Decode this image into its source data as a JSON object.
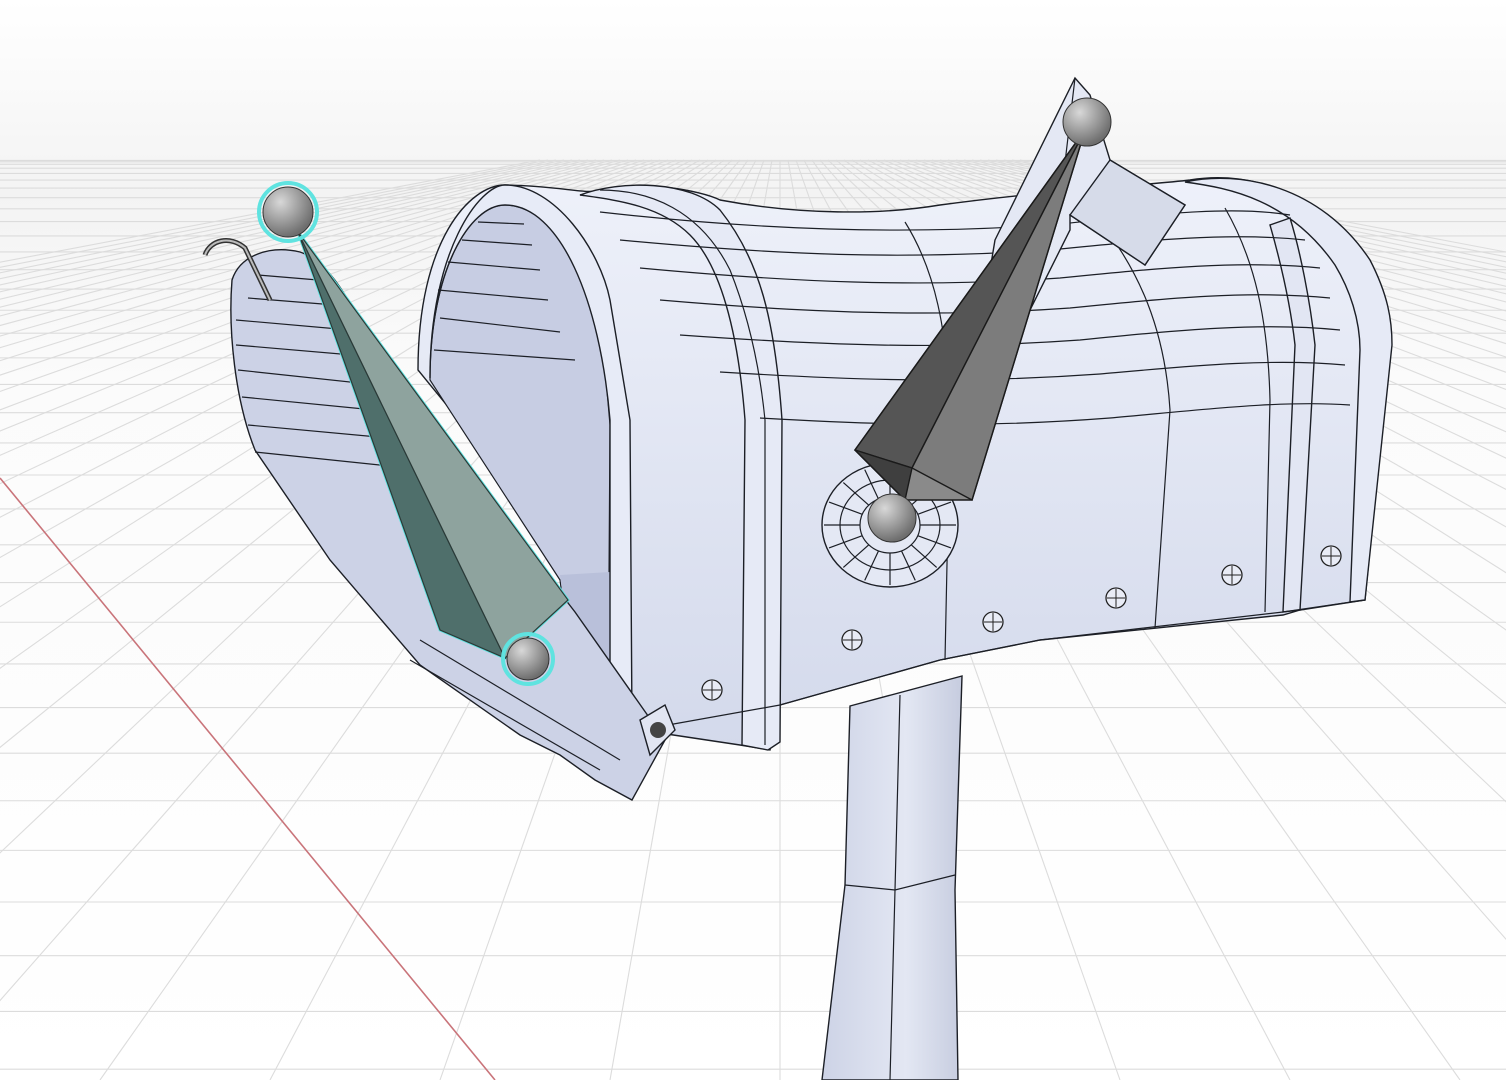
{
  "viewport": {
    "mode": "Object Mode",
    "shading": "wireframe-overlay",
    "grid": true,
    "x_axis_visible": true,
    "selection_outline_color": "#5fe3e0"
  },
  "scene": {
    "objects": [
      {
        "name": "mailbox-body",
        "type": "mesh",
        "selected": false
      },
      {
        "name": "mailbox-door",
        "type": "mesh",
        "selected": false
      },
      {
        "name": "mailbox-post",
        "type": "mesh",
        "selected": false
      },
      {
        "name": "flag",
        "type": "mesh",
        "selected": false
      },
      {
        "name": "door-bone",
        "type": "armature-bone",
        "selected": true
      },
      {
        "name": "flag-bone",
        "type": "armature-bone",
        "selected": false
      }
    ]
  },
  "colors": {
    "mesh_fill": "#dfe4f3",
    "mesh_shadow": "#c3c9de",
    "wire": "#1c1f26",
    "bone_fill": "#7b7b7b",
    "bone_selected_fill": "#7e9690",
    "grid_line": "#d9d9d9",
    "x_axis": "#c9747a",
    "background_top": "#f4f4f4",
    "background_bottom": "#ffffff"
  }
}
